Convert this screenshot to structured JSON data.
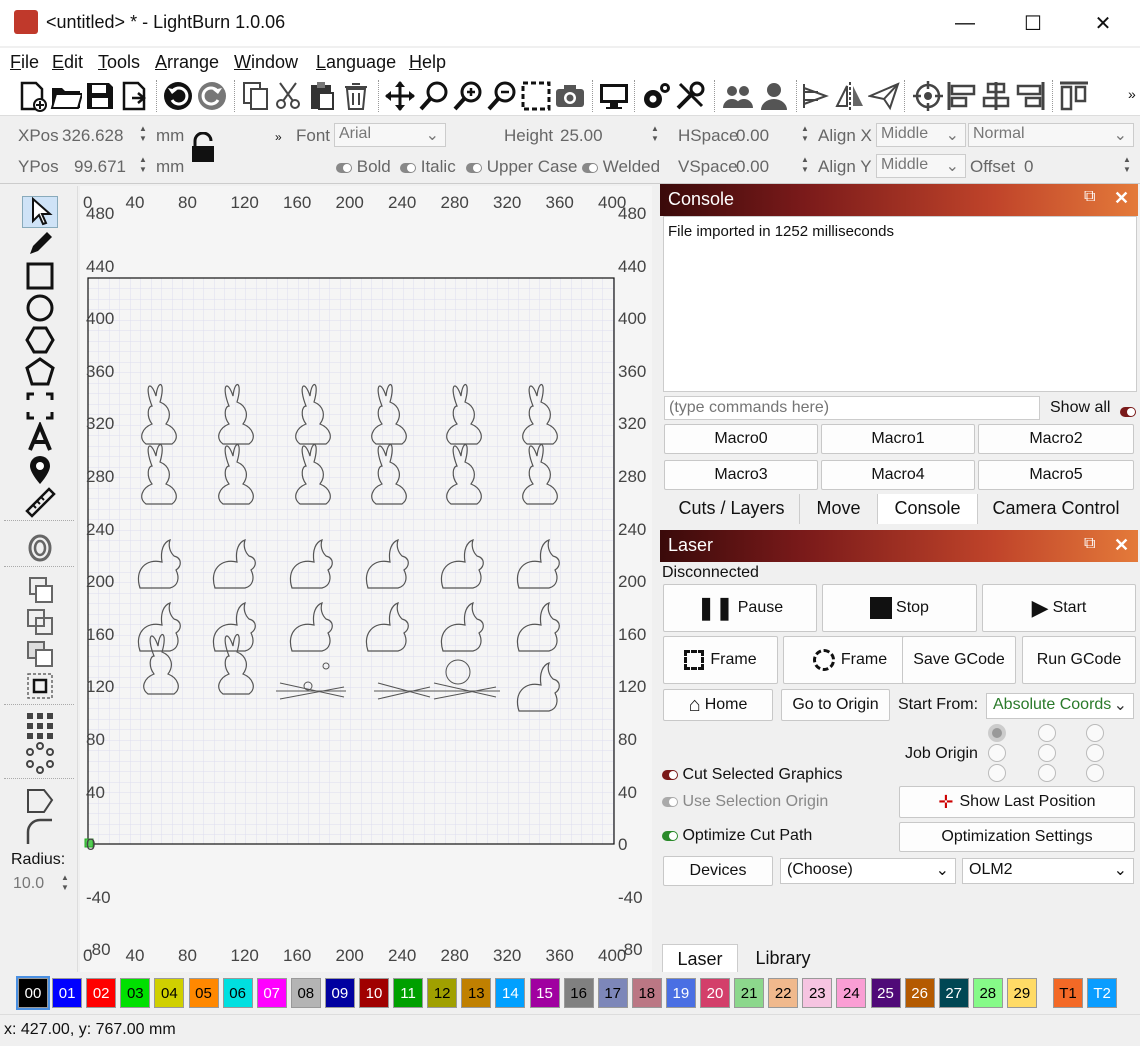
{
  "window": {
    "title": "<untitled> * - LightBurn 1.0.06",
    "minimize": "—",
    "maximize": "☐",
    "close": "✕"
  },
  "menu": {
    "items": [
      "File",
      "Edit",
      "Tools",
      "Arrange",
      "Window",
      "Language",
      "Help"
    ]
  },
  "toolbar": {
    "icons": [
      "new-file-icon",
      "open-folder-icon",
      "save-icon",
      "import-icon",
      "undo-icon",
      "redo-icon",
      "copy-icon",
      "cut-icon",
      "paste-icon",
      "delete-icon",
      "move-icon",
      "zoom-icon",
      "zoom-in-icon",
      "zoom-out-icon",
      "zoom-frame-icon",
      "camera-icon",
      "monitor-icon",
      "settings-icon",
      "tools-icon",
      "users-icon",
      "user-icon",
      "align-icon",
      "mirror-icon",
      "send-icon",
      "target-icon",
      "align-left-icon",
      "align-center-icon",
      "align-right-icon",
      "distribute-icon"
    ],
    "overflow": "»"
  },
  "props": {
    "xpos_label": "XPos",
    "xpos": "326.628",
    "ypos_label": "YPos",
    "ypos": "99.671",
    "unit": "mm",
    "unit2": "mm",
    "font_label": "Font",
    "font": "Arial",
    "height_label": "Height",
    "height": "25.00",
    "hspace_label": "HSpace",
    "hspace": "0.00",
    "vspace_label": "VSpace",
    "vspace": "0.00",
    "alignx_label": "Align X",
    "alignx": "Middle",
    "aligny_label": "Align Y",
    "aligny": "Middle",
    "normal": "Normal",
    "offset_label": "Offset",
    "offset": "0",
    "bold": "Bold",
    "italic": "Italic",
    "upper": "Upper Case",
    "welded": "Welded",
    "chev": "»"
  },
  "left_tools": {
    "radius_label": "Radius:",
    "radius": "10.0"
  },
  "ruler": {
    "top": [
      "0",
      "40",
      "80",
      "120",
      "160",
      "200",
      "240",
      "280",
      "320",
      "360",
      "400"
    ],
    "side": [
      "480",
      "440",
      "400",
      "360",
      "320",
      "280",
      "240",
      "200",
      "160",
      "120",
      "80",
      "40",
      "0",
      "-40",
      "-80"
    ],
    "corner": "0"
  },
  "console": {
    "title": "Console",
    "output": "File imported in 1252 milliseconds",
    "placeholder": "(type commands here)",
    "show_all": "Show all",
    "macros": [
      "Macro0",
      "Macro1",
      "Macro2",
      "Macro3",
      "Macro4",
      "Macro5"
    ],
    "tabs": [
      "Cuts / Layers",
      "Move",
      "Console",
      "Camera Control"
    ],
    "active_tab": "Console"
  },
  "laser": {
    "title": "Laser",
    "status": "Disconnected",
    "pause": "Pause",
    "stop": "Stop",
    "start": "Start",
    "frame1": "Frame",
    "frame2": "Frame",
    "save_gcode": "Save GCode",
    "run_gcode": "Run GCode",
    "home": "Home",
    "go_origin": "Go to Origin",
    "start_from_label": "Start From:",
    "start_from": "Absolute Coords",
    "job_origin_label": "Job Origin",
    "cut_selected": "Cut Selected Graphics",
    "use_selection": "Use Selection Origin",
    "optimize": "Optimize Cut Path",
    "show_last": "Show Last Position",
    "opt_settings": "Optimization Settings",
    "devices": "Devices",
    "choose": "(Choose)",
    "device": "OLM2",
    "tabs": [
      "Laser",
      "Library"
    ]
  },
  "palette": [
    {
      "l": "00",
      "c": "#000000",
      "t": "#ffffff"
    },
    {
      "l": "01",
      "c": "#0000ff",
      "t": "#ffffff"
    },
    {
      "l": "02",
      "c": "#ff0000",
      "t": "#ffffff"
    },
    {
      "l": "03",
      "c": "#00e000",
      "t": "#000000"
    },
    {
      "l": "04",
      "c": "#d0d000",
      "t": "#000000"
    },
    {
      "l": "05",
      "c": "#ff8800",
      "t": "#000000"
    },
    {
      "l": "06",
      "c": "#00e0e0",
      "t": "#000000"
    },
    {
      "l": "07",
      "c": "#ff00ff",
      "t": "#ffffff"
    },
    {
      "l": "08",
      "c": "#b4b4b4",
      "t": "#000000"
    },
    {
      "l": "09",
      "c": "#0000a0",
      "t": "#ffffff"
    },
    {
      "l": "10",
      "c": "#a00000",
      "t": "#ffffff"
    },
    {
      "l": "11",
      "c": "#00a000",
      "t": "#ffffff"
    },
    {
      "l": "12",
      "c": "#a0a000",
      "t": "#000000"
    },
    {
      "l": "13",
      "c": "#c08000",
      "t": "#000000"
    },
    {
      "l": "14",
      "c": "#00a0ff",
      "t": "#ffffff"
    },
    {
      "l": "15",
      "c": "#a000a0",
      "t": "#ffffff"
    },
    {
      "l": "16",
      "c": "#808080",
      "t": "#000000"
    },
    {
      "l": "17",
      "c": "#7d87b9",
      "t": "#000000"
    },
    {
      "l": "18",
      "c": "#bb7784",
      "t": "#000000"
    },
    {
      "l": "19",
      "c": "#4a6fe3",
      "t": "#ffffff"
    },
    {
      "l": "20",
      "c": "#d33f6a",
      "t": "#ffffff"
    },
    {
      "l": "21",
      "c": "#8cd78c",
      "t": "#000000"
    },
    {
      "l": "22",
      "c": "#f0b98d",
      "t": "#000000"
    },
    {
      "l": "23",
      "c": "#f6c4e1",
      "t": "#000000"
    },
    {
      "l": "24",
      "c": "#fa9ed4",
      "t": "#000000"
    },
    {
      "l": "25",
      "c": "#500a78",
      "t": "#ffffff"
    },
    {
      "l": "26",
      "c": "#b45a00",
      "t": "#ffffff"
    },
    {
      "l": "27",
      "c": "#004754",
      "t": "#ffffff"
    },
    {
      "l": "28",
      "c": "#86fa88",
      "t": "#000000"
    },
    {
      "l": "29",
      "c": "#ffdb66",
      "t": "#000000"
    },
    {
      "l": "T1",
      "c": "#f36926",
      "t": "#000000"
    },
    {
      "l": "T2",
      "c": "#0a9dff",
      "t": "#ffffff"
    }
  ],
  "status": {
    "coords": "x: 427.00, y: 767.00 mm"
  }
}
